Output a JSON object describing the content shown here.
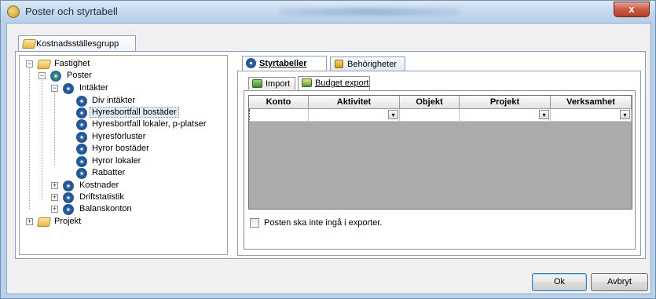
{
  "window": {
    "title": "Poster och styrtabell",
    "close_label": "x"
  },
  "outer_tab": {
    "label": "Kostnadsställesgrupp"
  },
  "tree": {
    "root": "Fastighet",
    "poster": "Poster",
    "intakter": "Intäkter",
    "children": [
      "Div intäkter",
      "Hyresbortfall bostäder",
      "Hyresbortfall lokaler, p-platser",
      "Hyresförluster",
      "Hyror bostäder",
      "Hyror lokaler",
      "Rabatter"
    ],
    "kostnader": "Kostnader",
    "driftstatistik": "Driftstatistik",
    "balanskonton": "Balanskonton",
    "projekt": "Projekt",
    "selected": "Hyresbortfall bostäder"
  },
  "tabs": {
    "styrtabeller": "Styrtabeller",
    "behorigheter": "Behörigheter"
  },
  "sub_tabs": {
    "import": "Import",
    "budget_export": "Budget export"
  },
  "grid": {
    "columns": [
      "Konto",
      "Aktivitet",
      "Objekt",
      "Projekt",
      "Verksamhet"
    ],
    "dropdown_glyph": "▾"
  },
  "checkbox": {
    "label": "Posten ska inte ingå i exporter.",
    "checked": false
  },
  "buttons": {
    "ok": "Ok",
    "cancel": "Avbryt"
  }
}
